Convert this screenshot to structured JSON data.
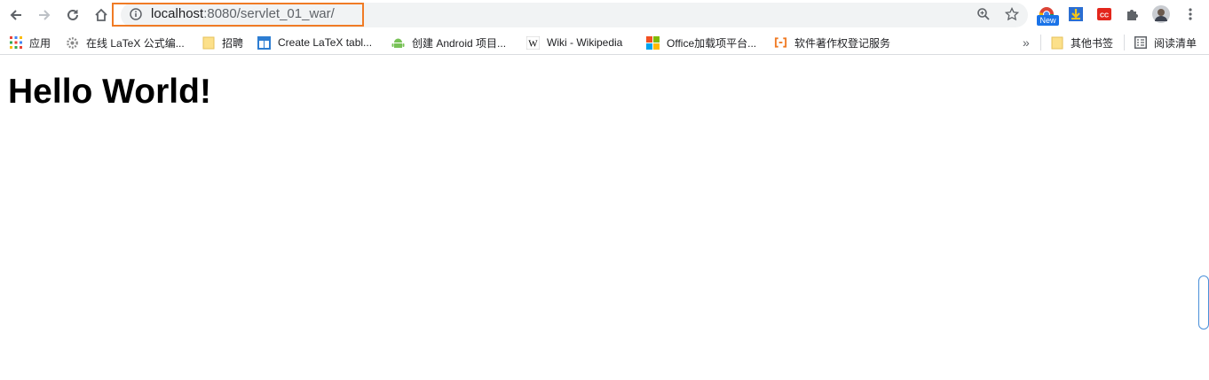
{
  "address_bar": {
    "host": "localhost",
    "path": ":8080/servlet_01_war/"
  },
  "extensions": {
    "new_badge": "New"
  },
  "bookmarks": {
    "items": [
      {
        "label": "应用",
        "icon": "apps-grid-icon"
      },
      {
        "label": "在线 LaTeX 公式编...",
        "icon": "gear-icon"
      },
      {
        "label": "招聘",
        "icon": "folder-icon"
      },
      {
        "label": "Create LaTeX tabl...",
        "icon": "table-icon"
      },
      {
        "label": "创建 Android 项目...",
        "icon": "android-icon"
      },
      {
        "label": "Wiki - Wikipedia",
        "icon": "wikipedia-icon"
      },
      {
        "label": "Office加载项平台...",
        "icon": "office-icon"
      },
      {
        "label": "软件著作权登记服务",
        "icon": "bracket-icon"
      }
    ],
    "other_folder": "其他书签",
    "reading_list": "阅读清单"
  },
  "page": {
    "heading": "Hello World!"
  },
  "colors": {
    "highlight": "#f07b25",
    "omnibox_bg": "#f1f3f4"
  }
}
